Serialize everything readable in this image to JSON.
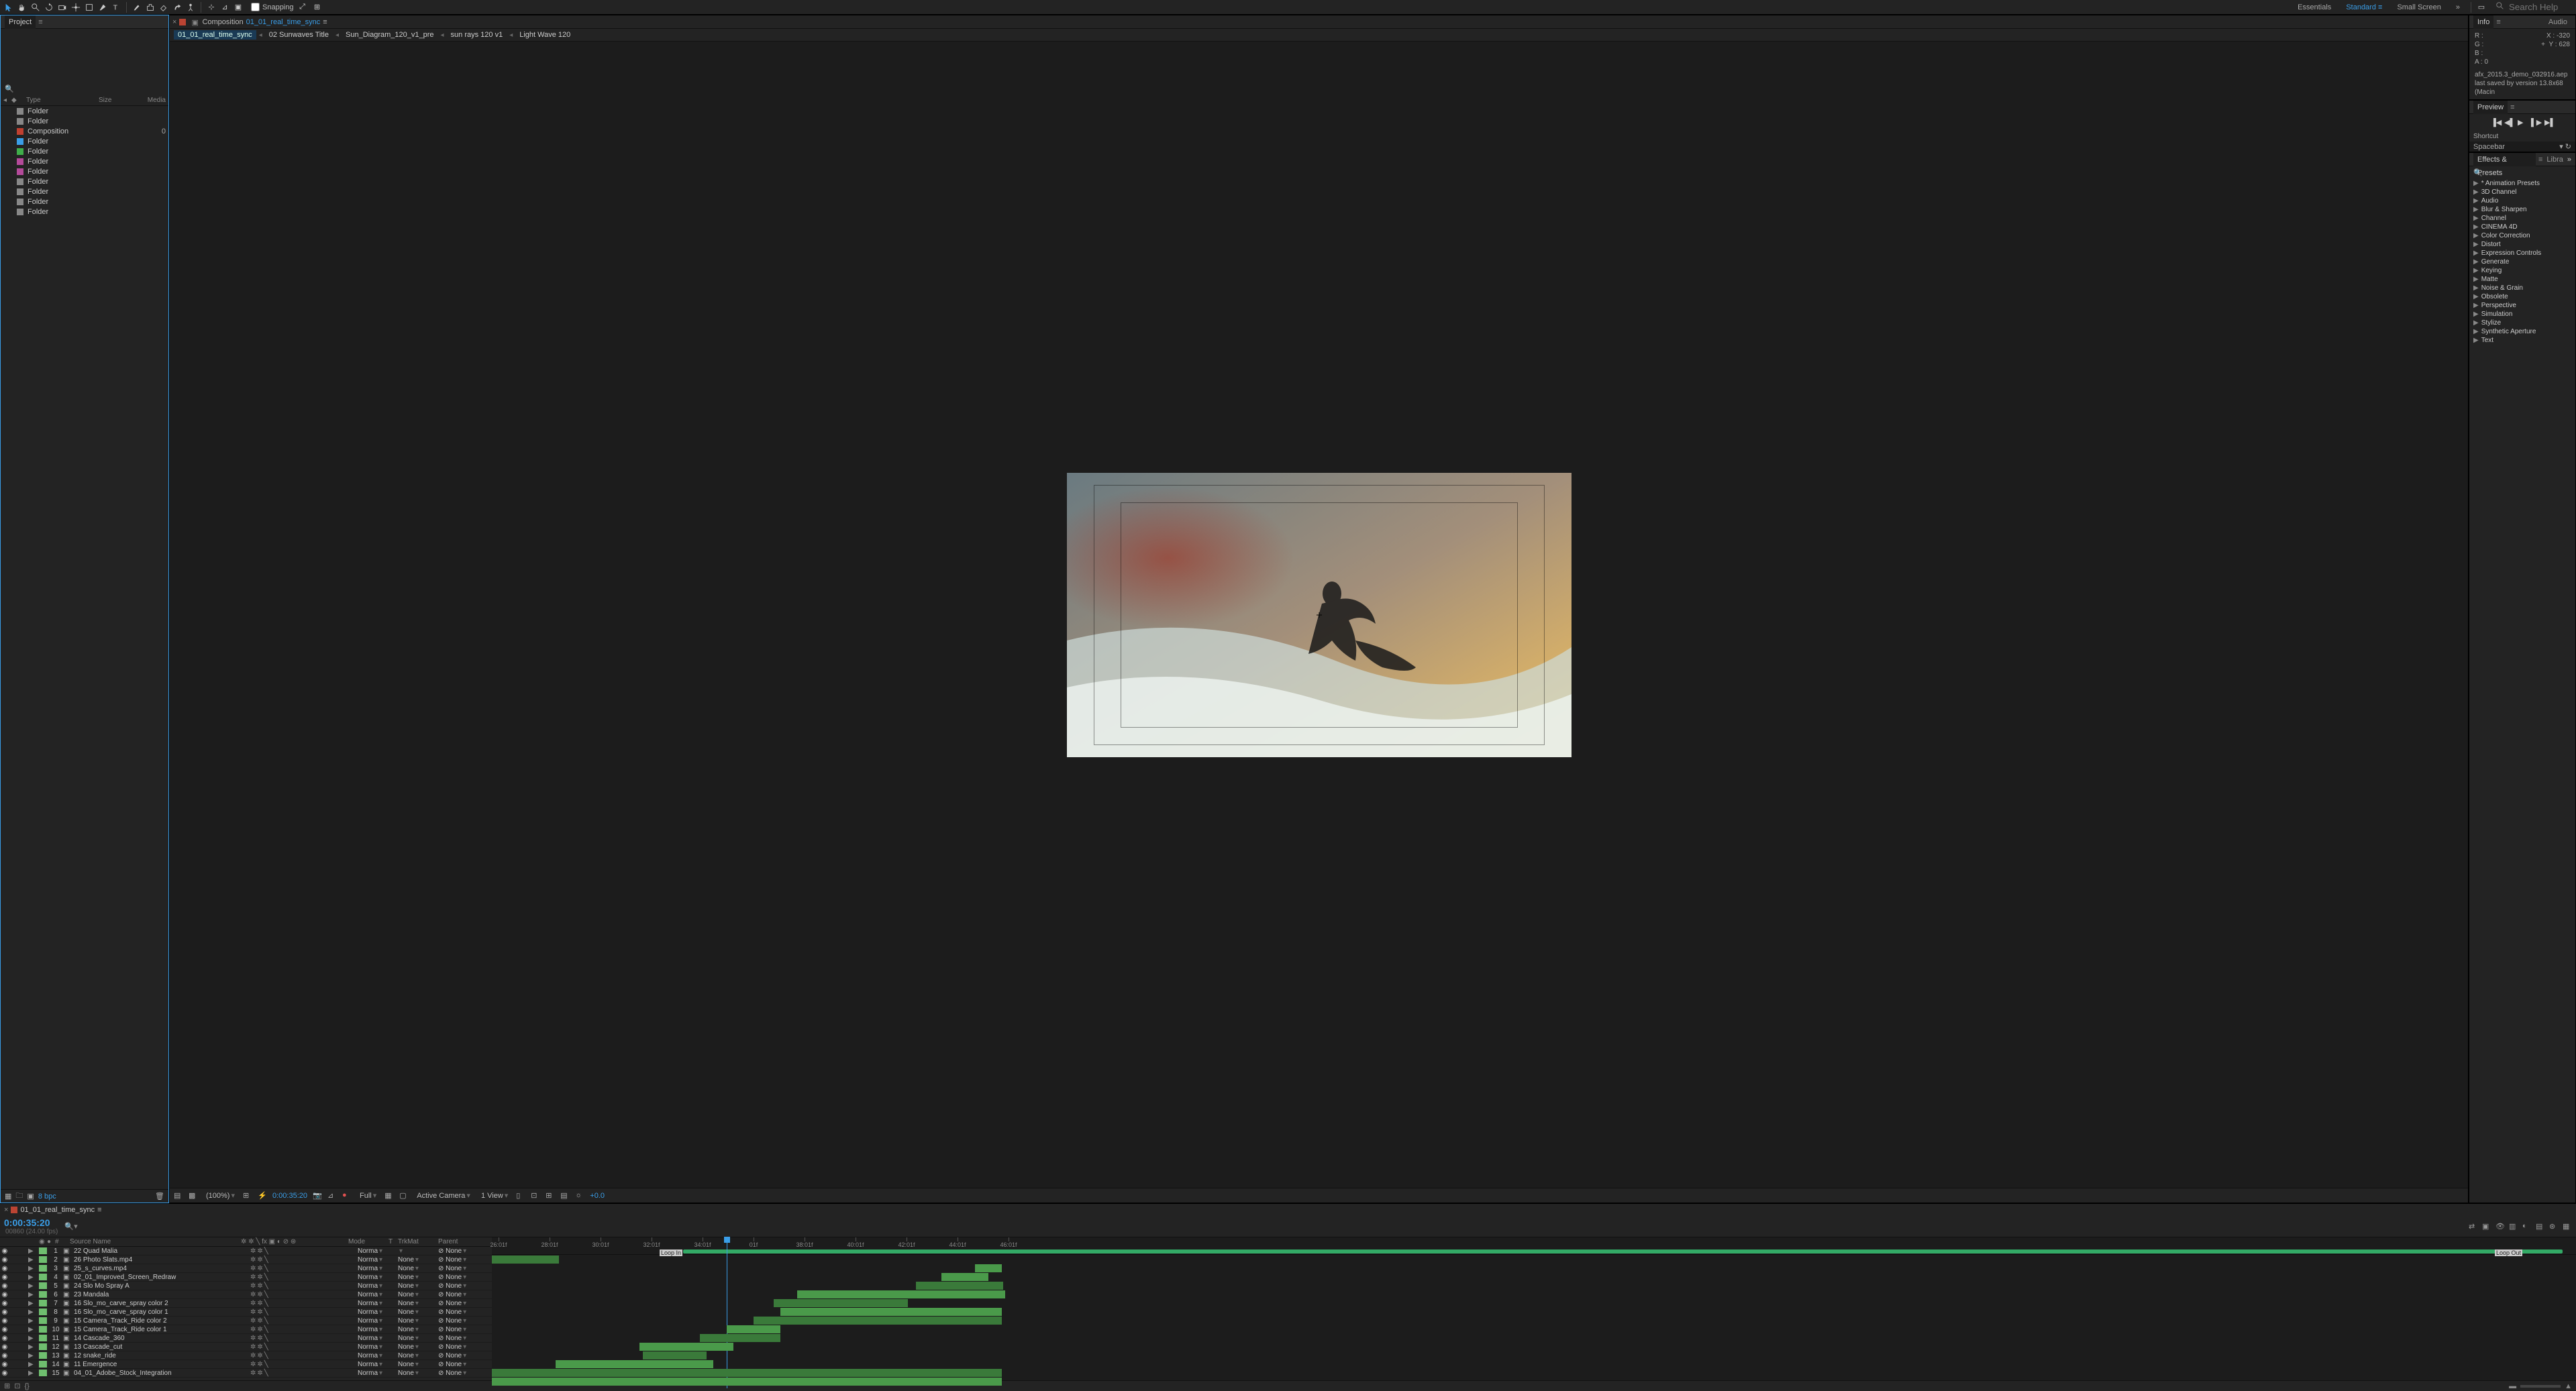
{
  "topbar": {
    "snapping_label": "Snapping",
    "workspaces": [
      "Essentials",
      "Standard",
      "Small Screen"
    ],
    "active_workspace": "Standard",
    "search_placeholder": "Search Help"
  },
  "workspace_expand_icon": "»",
  "project": {
    "panel_title": "Project",
    "search_placeholder": "",
    "columns": {
      "type": "Type",
      "size": "Size",
      "media": "Media"
    },
    "items": [
      {
        "color": "#888888",
        "type": "Folder",
        "size": ""
      },
      {
        "color": "#888888",
        "type": "Folder",
        "size": ""
      },
      {
        "color": "#c04030",
        "type": "Composition",
        "size": "0"
      },
      {
        "color": "#3a9ee8",
        "type": "Folder",
        "size": ""
      },
      {
        "color": "#3fae4a",
        "type": "Folder",
        "size": ""
      },
      {
        "color": "#b44a9a",
        "type": "Folder",
        "size": ""
      },
      {
        "color": "#b44a9a",
        "type": "Folder",
        "size": ""
      },
      {
        "color": "#888888",
        "type": "Folder",
        "size": ""
      },
      {
        "color": "#888888",
        "type": "Folder",
        "size": ""
      },
      {
        "color": "#888888",
        "type": "Folder",
        "size": ""
      },
      {
        "color": "#888888",
        "type": "Folder",
        "size": ""
      }
    ],
    "bpc": "8 bpc"
  },
  "composition": {
    "panel_label": "Composition",
    "active_name": "01_01_real_time_sync",
    "breadcrumb": [
      "01_01_real_time_sync",
      "02 Sunwaves Title",
      "Sun_Diagram_120_v1_pre",
      "sun rays 120 v1",
      "Light Wave 120"
    ]
  },
  "viewer_footer": {
    "zoom": "(100%)",
    "time": "0:00:35:20",
    "resolution": "Full",
    "camera": "Active Camera",
    "views": "1 View",
    "exposure": "+0.0"
  },
  "info": {
    "panel_title": "Info",
    "audio_tab": "Audio",
    "r": "R :",
    "g": "G :",
    "b": "B :",
    "a": "A : 0",
    "x_label": "X :",
    "x_val": "-320",
    "y_label": "Y :",
    "y_val": "628",
    "file": "afx_2015.3_demo_032916.aep",
    "saved": "last saved by version 13.8x68 (Macin"
  },
  "preview": {
    "panel_title": "Preview",
    "shortcut_label": "Shortcut",
    "shortcut_value": "Spacebar"
  },
  "effects": {
    "panel_title": "Effects & Presets",
    "libra_tab": "Libra",
    "items": [
      "* Animation Presets",
      "3D Channel",
      "Audio",
      "Blur & Sharpen",
      "Channel",
      "CINEMA 4D",
      "Color Correction",
      "Distort",
      "Expression Controls",
      "Generate",
      "Keying",
      "Matte",
      "Noise & Grain",
      "Obsolete",
      "Perspective",
      "Simulation",
      "Stylize",
      "Synthetic Aperture",
      "Text"
    ]
  },
  "timeline": {
    "tab_name": "01_01_real_time_sync",
    "time": "0:00:35:20",
    "frames": "00860 (24.00 fps)",
    "cols": {
      "num": "#",
      "src": "Source Name",
      "mode": "Mode",
      "trk": "TrkMat",
      "parent": "Parent"
    },
    "mode_val": "Norma",
    "trk_val": "None",
    "parent_val": "None",
    "loop_in": "Loop In",
    "loop_out": "Loop Out",
    "ruler_labels": [
      "26:01f",
      "28:01f",
      "30:01f",
      "32:01f",
      "34:01f",
      "01f",
      "38:01f",
      "40:01f",
      "42:01f",
      "44:01f",
      "46:01f"
    ],
    "layers": [
      {
        "n": 1,
        "color": "#6fbf6f",
        "name": "22 Quad Malia",
        "start": 0,
        "len": 100,
        "shade": "dark"
      },
      {
        "n": 2,
        "color": "#6fbf6f",
        "name": "26 Photo Slats.mp4",
        "start": 720,
        "len": 40
      },
      {
        "n": 3,
        "color": "#6fbf6f",
        "name": "25_s_curves.mp4",
        "start": 670,
        "len": 70
      },
      {
        "n": 4,
        "color": "#6fbf6f",
        "name": "02_01_Improved_Screen_Redraw",
        "start": 632,
        "len": 130,
        "shade": "dark"
      },
      {
        "n": 5,
        "color": "#6fbf6f",
        "name": "24 Slo Mo Spray A",
        "start": 455,
        "len": 310
      },
      {
        "n": 6,
        "color": "#6fbf6f",
        "name": "23 Mandala",
        "start": 420,
        "len": 200,
        "shade": "dark"
      },
      {
        "n": 7,
        "color": "#6fbf6f",
        "name": "16 Slo_mo_carve_spray color 2",
        "start": 430,
        "len": 330
      },
      {
        "n": 8,
        "color": "#6fbf6f",
        "name": "16 Slo_mo_carve_spray color 1",
        "start": 390,
        "len": 370,
        "shade": "dark"
      },
      {
        "n": 9,
        "color": "#6fbf6f",
        "name": "15 Camera_Track_Ride color 2",
        "start": 350,
        "len": 80
      },
      {
        "n": 10,
        "color": "#6fbf6f",
        "name": "15 Camera_Track_Ride color 1",
        "start": 310,
        "len": 120,
        "shade": "dark"
      },
      {
        "n": 11,
        "color": "#6fbf6f",
        "name": "14 Cascade_360",
        "start": 220,
        "len": 140
      },
      {
        "n": 12,
        "color": "#6fbf6f",
        "name": "13 Cascade_cut",
        "start": 225,
        "len": 95,
        "shade": "dark"
      },
      {
        "n": 13,
        "color": "#6fbf6f",
        "name": "12 snake_ride",
        "start": 95,
        "len": 235
      },
      {
        "n": 14,
        "color": "#6fbf6f",
        "name": "11 Emergence",
        "start": 0,
        "len": 760,
        "shade": "dark"
      },
      {
        "n": 15,
        "color": "#6fbf6f",
        "name": "04_01_Adobe_Stock_Integration",
        "start": 0,
        "len": 760
      }
    ]
  }
}
